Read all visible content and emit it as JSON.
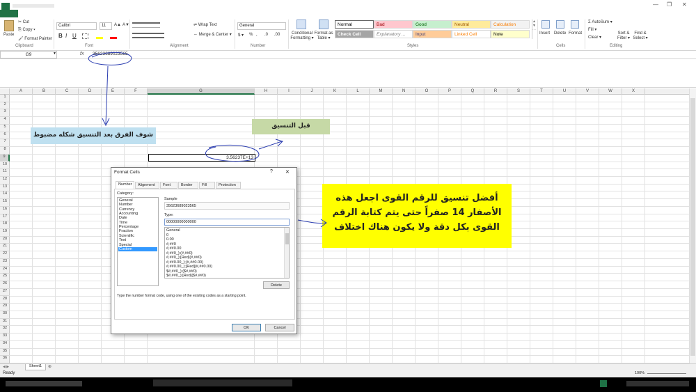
{
  "window": {
    "min": "—",
    "restore": "❐",
    "close": "✕"
  },
  "ribbon": {
    "clipboard": {
      "paste": "Paste",
      "cut": "Cut",
      "copy": "Copy ▾",
      "painter": "Format Painter",
      "group": "Clipboard"
    },
    "font": {
      "name": "Calibri",
      "size": "11",
      "grow": "A▲",
      "shrink": "A▼",
      "bold": "B",
      "italic": "I",
      "underline": "U",
      "group": "Font"
    },
    "alignment": {
      "wrap": "Wrap Text",
      "merge": "Merge & Center ▾",
      "group": "Alignment"
    },
    "number": {
      "format": "General",
      "currency": "$ ▾",
      "percent": "%",
      "comma": ",",
      "incdec": ".0",
      "decdec": ".00",
      "group": "Number"
    },
    "styles": {
      "conditional": "Conditional Formatting ▾",
      "table": "Format as Table ▾",
      "cells": [
        {
          "label": "Normal",
          "bg": "#ffffff",
          "color": "#000000"
        },
        {
          "label": "Bad",
          "bg": "#ffc7ce",
          "color": "#9c0006"
        },
        {
          "label": "Good",
          "bg": "#c6efce",
          "color": "#006100"
        },
        {
          "label": "Neutral",
          "bg": "#ffeb9c",
          "color": "#9c5700"
        },
        {
          "label": "Calculation",
          "bg": "#f2f2f2",
          "color": "#fa7d00"
        },
        {
          "label": "Check Cell",
          "bg": "#a5a5a5",
          "color": "#ffffff"
        },
        {
          "label": "Explanatory ...",
          "bg": "#ffffff",
          "color": "#7f7f7f"
        },
        {
          "label": "Input",
          "bg": "#ffcc99",
          "color": "#3f3f76"
        },
        {
          "label": "Linked Cell",
          "bg": "#ffffff",
          "color": "#fa7d00"
        },
        {
          "label": "Note",
          "bg": "#ffffcc",
          "color": "#000000"
        }
      ],
      "group": "Styles"
    },
    "cells": {
      "insert": "Insert",
      "delete": "Delete",
      "format": "Format",
      "group": "Cells"
    },
    "editing": {
      "autosum": "Σ AutoSum ▾",
      "fill": "Fill ▾",
      "clear": "Clear ▾",
      "sort": "Sort & Filter ▾",
      "find": "Find & Select ▾",
      "group": "Editing"
    }
  },
  "formula_bar": {
    "name_box": "G9",
    "fx": "fx",
    "value": "35623689023565"
  },
  "columns": [
    "A",
    "B",
    "C",
    "D",
    "E",
    "F",
    "G",
    "H",
    "I",
    "J",
    "K",
    "L",
    "M",
    "N",
    "O",
    "P",
    "Q",
    "R",
    "S",
    "T",
    "U",
    "V",
    "W",
    "X"
  ],
  "rows": [
    "1",
    "2",
    "3",
    "4",
    "5",
    "6",
    "7",
    "8",
    "9",
    "10",
    "11",
    "12",
    "13",
    "14",
    "15",
    "16",
    "17",
    "18",
    "19",
    "20",
    "21",
    "22",
    "23",
    "24",
    "25",
    "26",
    "27",
    "28",
    "29",
    "30",
    "31",
    "32",
    "33",
    "34",
    "35",
    "36"
  ],
  "cell_g9": "3.56237E+13",
  "notes": {
    "blue": "شوف الفرق بعد التنسيق شكله مضبوط",
    "green": "قبل التنسيق",
    "yellow": "أفضل تنسيق للرقم القوى اجعل هذه الأصفار 14 صفراً حتى يتم كتابة الرقم القوى بكل دقة ولا يكون هناك اختلاف"
  },
  "dialog": {
    "title": "Format Cells",
    "help": "?",
    "close": "✕",
    "tabs": [
      "Number",
      "Alignment",
      "Font",
      "Border",
      "Fill",
      "Protection"
    ],
    "category_label": "Category:",
    "categories": [
      "General",
      "Number",
      "Currency",
      "Accounting",
      "Date",
      "Time",
      "Percentage",
      "Fraction",
      "Scientific",
      "Text",
      "Special",
      "Custom"
    ],
    "selected_category": "Custom",
    "sample_label": "Sample",
    "sample_value": "35623689023565",
    "type_label": "Type:",
    "type_value": "00000000000000",
    "formats": [
      "General",
      "0",
      "0.00",
      "#,##0",
      "#,##0.00",
      "#,##0_);(#,##0)",
      "#,##0_);[Red](#,##0)",
      "#,##0.00_);(#,##0.00)",
      "#,##0.00_);[Red](#,##0.00)",
      "$#,##0_);($#,##0)",
      "$#,##0_);[Red]($#,##0)"
    ],
    "delete": "Delete",
    "hint": "Type the number format code, using one of the existing codes as a starting point.",
    "ok": "OK",
    "cancel": "Cancel"
  },
  "sheet_tab": "Sheet1",
  "status": {
    "ready": "Ready",
    "zoom": "100%"
  }
}
